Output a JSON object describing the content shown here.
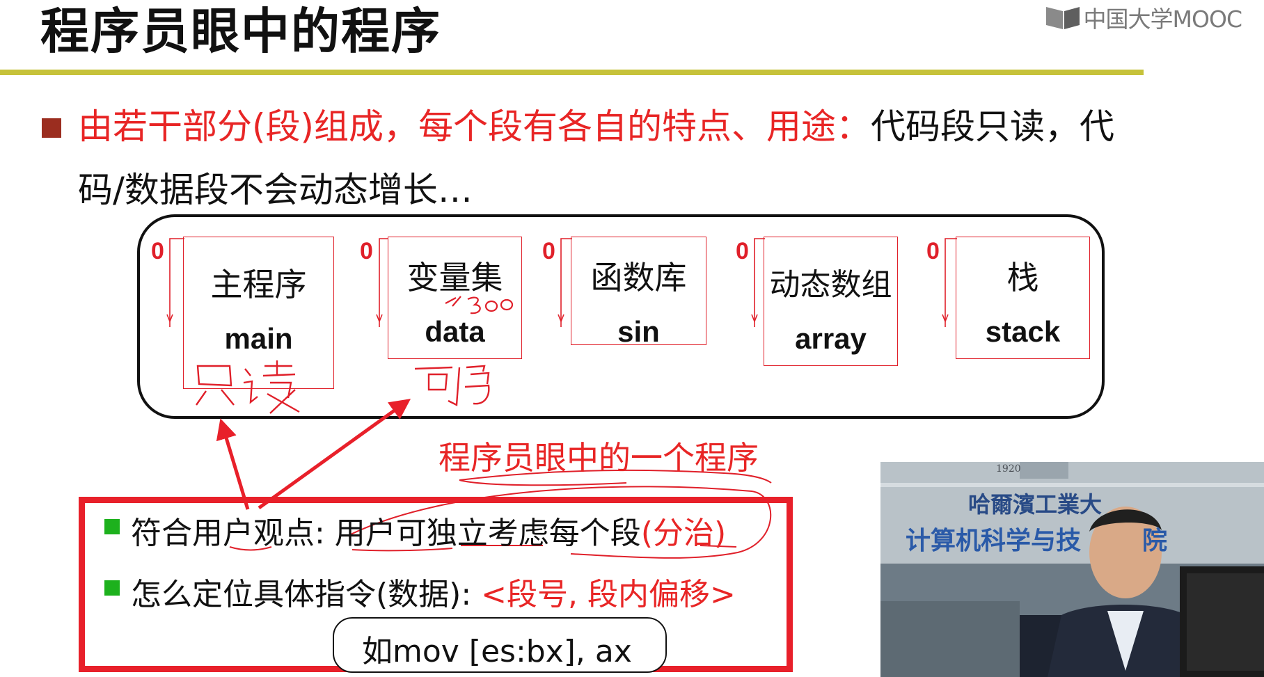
{
  "slide": {
    "title": "程序员眼中的程序",
    "logo_text": "中国大学MOOC",
    "bullet_red": "由若干部分(段)组成，每个段有各自的特点、用途：",
    "bullet_black": "代码段只读，代",
    "bullet_line2": "码/数据段不会动态增长…",
    "segments": [
      {
        "cn": "主程序",
        "en": "main",
        "zero": "0"
      },
      {
        "cn": "变量集",
        "en": "data",
        "zero": "0"
      },
      {
        "cn": "函数库",
        "en": "sin",
        "zero": "0"
      },
      {
        "cn": "动态数组",
        "en": "array",
        "zero": "0"
      },
      {
        "cn": "栈",
        "en": "stack",
        "zero": "0"
      }
    ],
    "handwriting": {
      "main_note": "只读",
      "data_note": "可写",
      "data_size": "300"
    },
    "caption": "程序员眼中的一个程序",
    "points": {
      "p1_black": "符合用户观点: 用户可独立考虑每个段",
      "p1_red": "(分治)",
      "p2_black": "怎么定位具体指令(数据): ",
      "p2_red": "<段号, 段内偏移>",
      "example": "如mov [es:bx], ax"
    },
    "video": {
      "banner_line1": "哈爾濱工業大",
      "banner_line2": "计算机科学与技",
      "banner_suffix": "院",
      "crest_year": "1920"
    },
    "colors": {
      "title_rule": "#c6c23a",
      "accent_red": "#e82525",
      "bullet_brown": "#9b2d1f",
      "bullet_green": "#1db11d"
    }
  }
}
